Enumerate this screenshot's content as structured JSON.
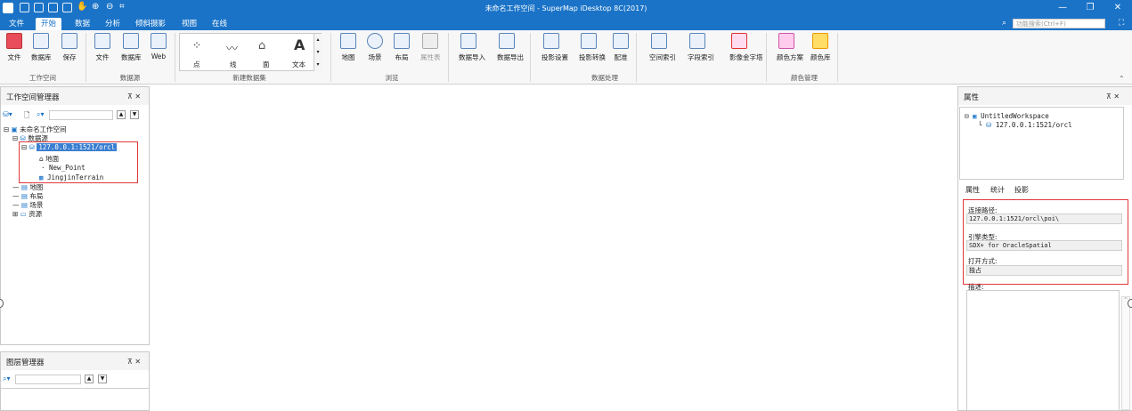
{
  "titlebar": {
    "title": "未命名工作空间 - SuperMap iDesktop 8C(2017)",
    "min": "—",
    "restore": "❐",
    "close": "✕"
  },
  "menu": {
    "tabs": [
      "文件",
      "开始",
      "数据",
      "分析",
      "倾斜摄影",
      "视图",
      "在线"
    ],
    "active": "开始",
    "search_placeholder": "功能搜索(Ctrl+F)"
  },
  "ribbon": {
    "buttons": {
      "file1": "文件",
      "database1": "数据库",
      "save": "保存",
      "file2": "文件",
      "database2": "数据库",
      "web": "Web",
      "point": "点",
      "line": "线",
      "region": "面",
      "text": "文本",
      "map": "地图",
      "scene": "场景",
      "layout": "布局",
      "attrtable": "属性表",
      "import": "数据导入",
      "export": "数据导出",
      "projset": "投影设置",
      "projconv": "投影转换",
      "register": "配准",
      "spatialidx": "空间索引",
      "fieldidx": "字段索引",
      "pyramid": "影像金字塔",
      "colorscheme": "颜色方案",
      "colortable": "颜色库"
    },
    "groups": {
      "workspace": "工作空间",
      "datasource": "数据源",
      "newdataset": "新建数据集",
      "browse": "浏览",
      "dataproc": "数据处理",
      "colormgmt": "颜色管理"
    }
  },
  "workspace_panel": {
    "title": "工作空间管理器",
    "pin": "⊼ ✕",
    "tree": {
      "root": "未命名工作空间",
      "datasources": "数据源",
      "ds": "127.0.0.1:1521/orcl",
      "datasets": [
        "地面",
        "New_Point",
        "JingjinTerrain"
      ],
      "maps": "地图",
      "layouts": "布局",
      "scenes": "场景",
      "resources": "资源"
    }
  },
  "layer_panel": {
    "title": "图层管理器",
    "pin": "⊼ ✕"
  },
  "properties_panel": {
    "title": "属性",
    "pin": "⊼ ✕",
    "tree_root": "UntitledWorkspace",
    "tree_child": "127.0.0.1:1521/orcl",
    "tabs": [
      "属性",
      "统计",
      "投影"
    ],
    "conn_label": "连接路径:",
    "conn_value": "127.0.0.1:1521/orcl\\poi\\",
    "engine_label": "引擎类型:",
    "engine_value": "SDX+ for OracleSpatial",
    "open_label": "打开方式:",
    "open_value": "独占",
    "desc_label": "描述:"
  }
}
